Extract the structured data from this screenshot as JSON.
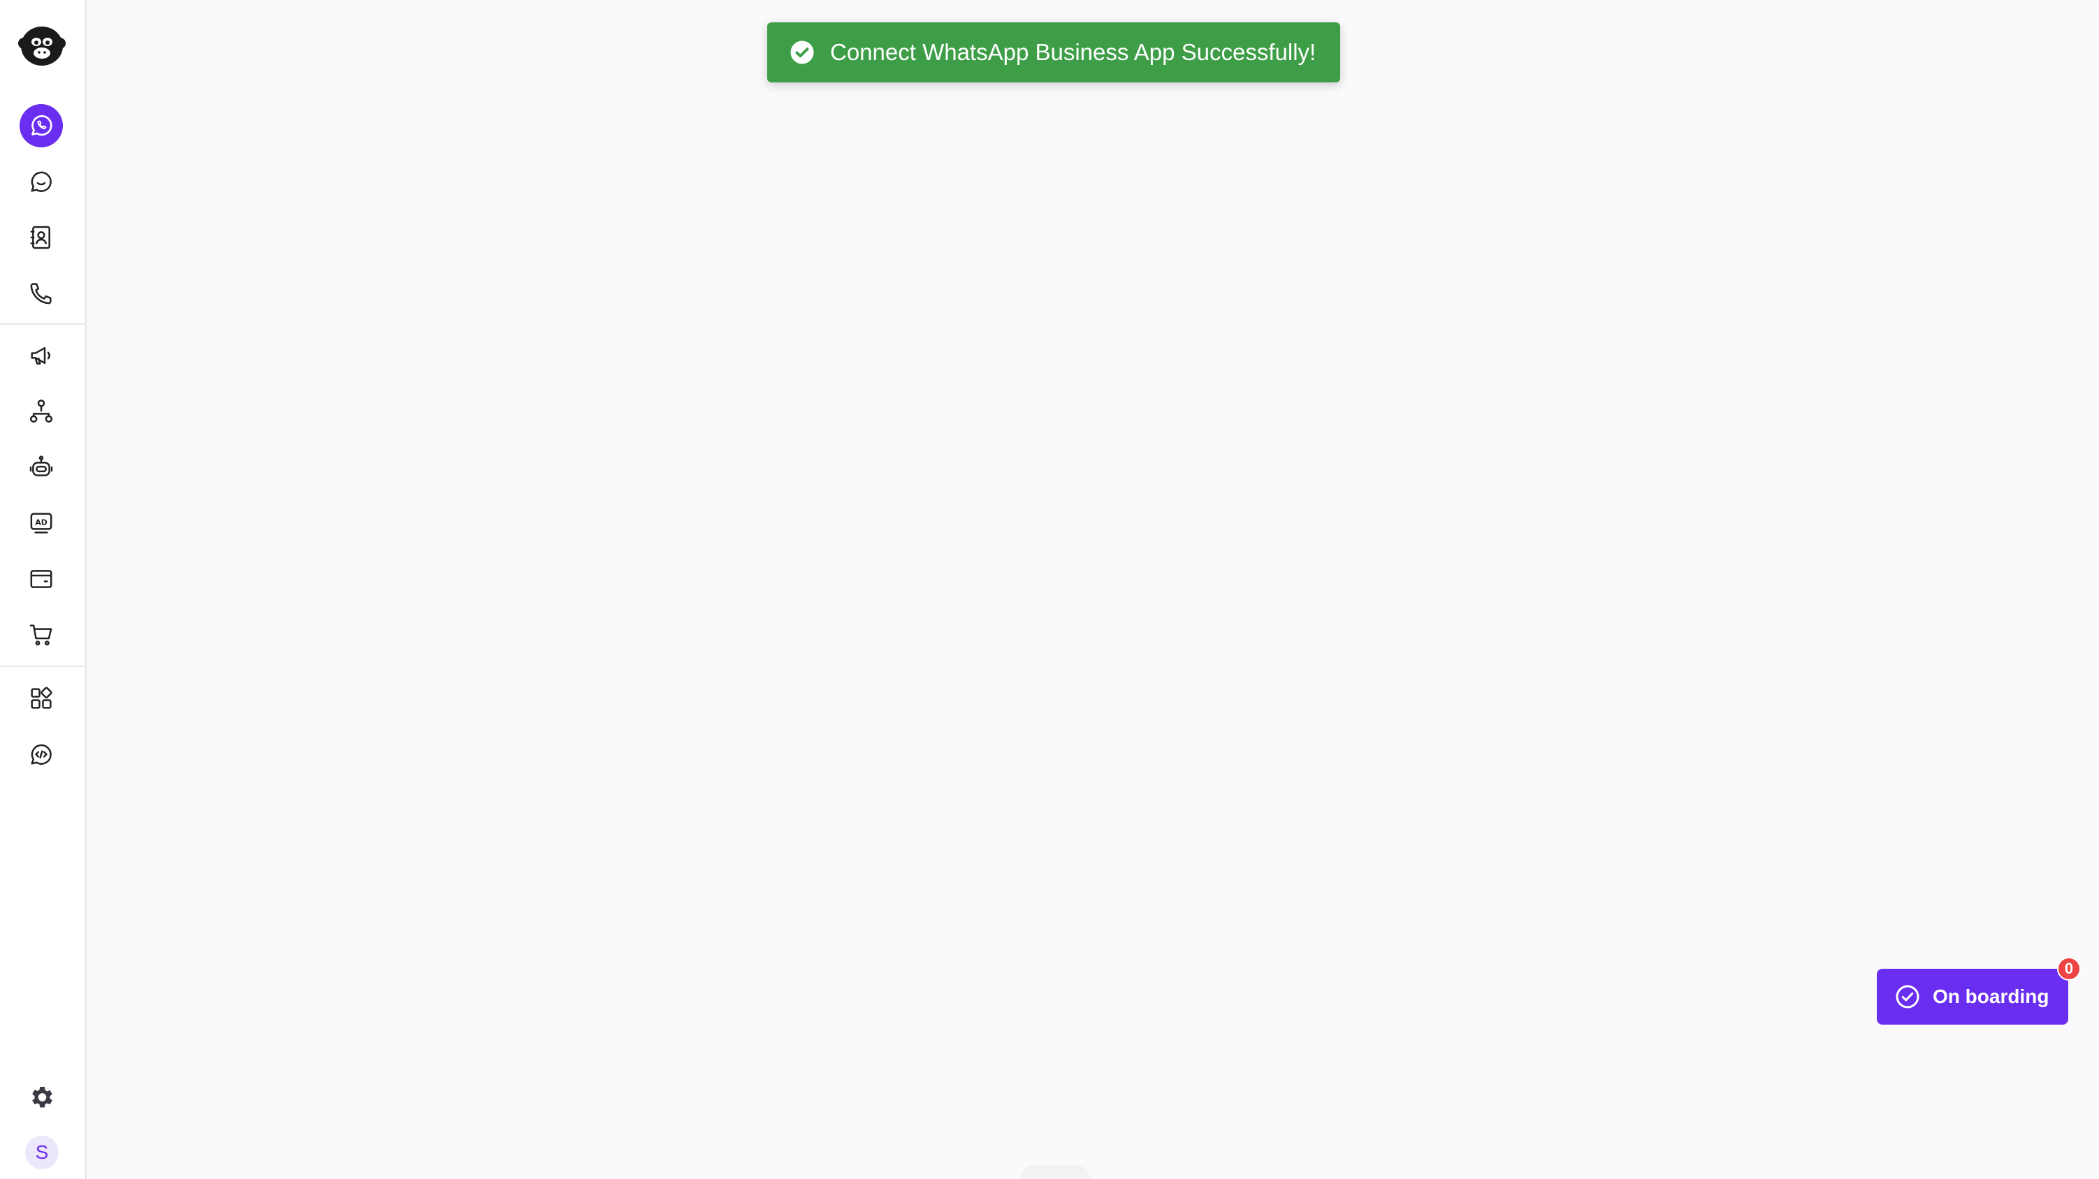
{
  "toast": {
    "message": "Connect WhatsApp Business App Successfully!",
    "icon": "check-circle-icon",
    "color": "#3e9e48"
  },
  "sidebar": {
    "logo": "monkey-logo-icon",
    "items": [
      {
        "name": "whatsapp-icon",
        "active": true
      },
      {
        "name": "chat-icon",
        "active": false
      },
      {
        "name": "contacts-icon",
        "active": false
      },
      {
        "name": "phone-icon",
        "active": false
      },
      {
        "name": "megaphone-icon",
        "active": false
      },
      {
        "name": "flow-icon",
        "active": false
      },
      {
        "name": "bot-icon",
        "active": false
      },
      {
        "name": "ads-icon",
        "active": false
      },
      {
        "name": "wallet-icon",
        "active": false
      },
      {
        "name": "cart-icon",
        "active": false
      },
      {
        "name": "apps-icon",
        "active": false
      },
      {
        "name": "developer-icon",
        "active": false
      },
      {
        "name": "settings-icon",
        "active": false
      }
    ],
    "avatar_initial": "S",
    "accent": "#6a2ef0"
  },
  "onboarding": {
    "label": "On boarding",
    "badge_count": "0",
    "icon": "check-circle-icon",
    "color": "#6a2ef0",
    "badge_color": "#ef4444"
  }
}
